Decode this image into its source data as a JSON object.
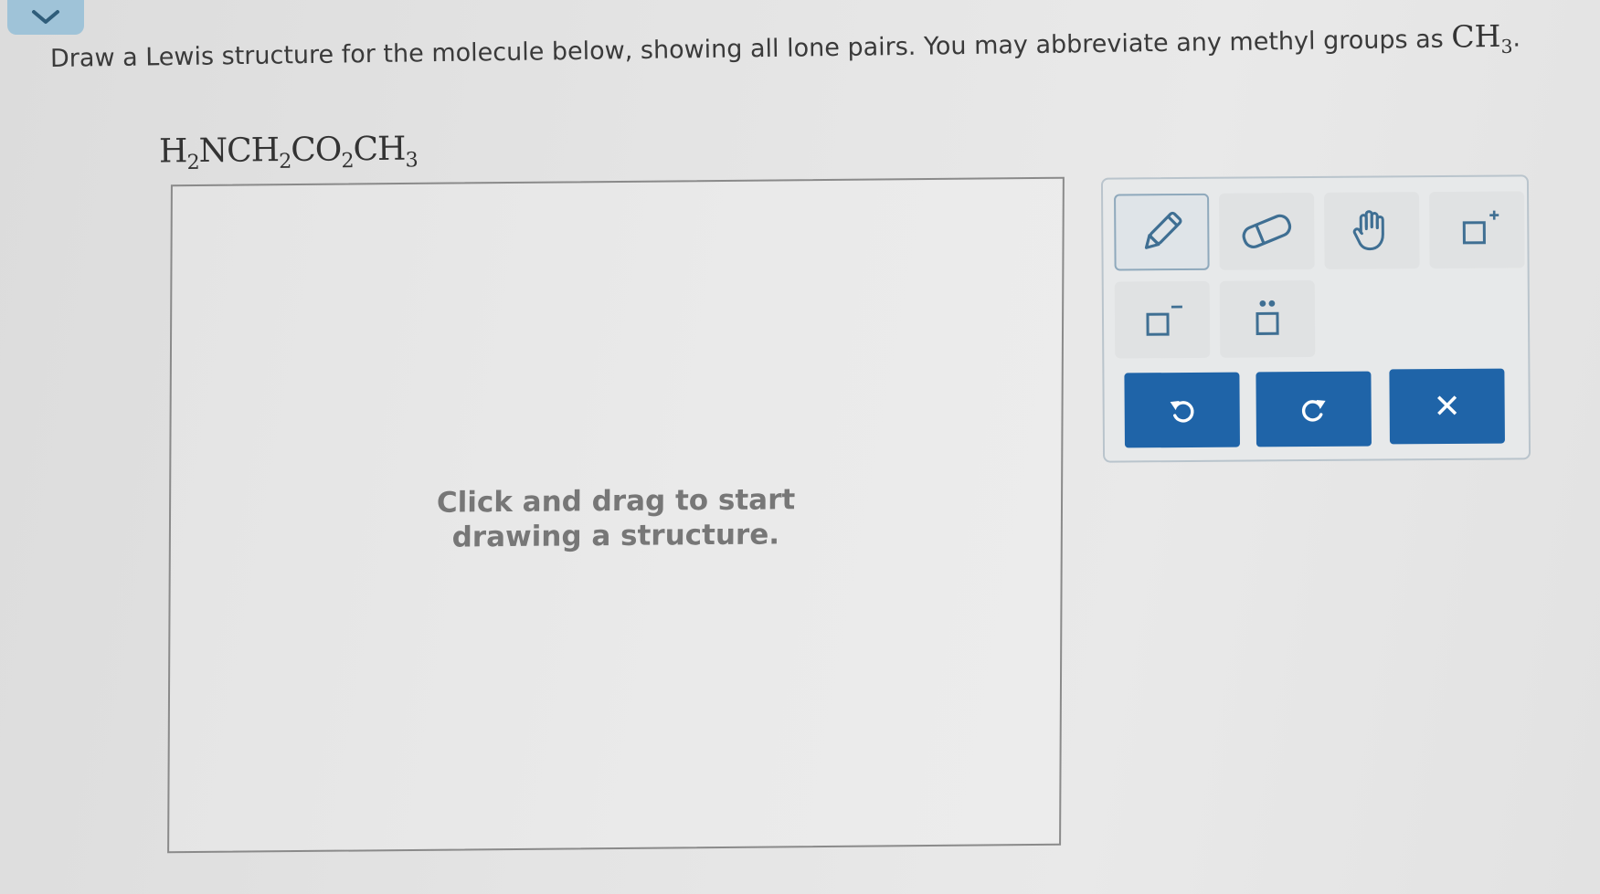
{
  "instruction": {
    "text": "Draw a Lewis structure for the molecule below, showing all lone pairs. You may abbreviate any methyl groups as ",
    "methyl": {
      "main": "CH",
      "sub": "3",
      "end": "."
    }
  },
  "formula": {
    "parts": [
      {
        "t": "H",
        "s": "2"
      },
      {
        "t": "NCH",
        "s": "2"
      },
      {
        "t": "CO",
        "s": "2"
      },
      {
        "t": "CH",
        "s": "3"
      }
    ]
  },
  "canvas": {
    "hint": "Click and drag to start\ndrawing a structure."
  },
  "toolbar": {
    "tools": [
      {
        "name": "pencil-tool",
        "icon": "pencil-icon",
        "active": true
      },
      {
        "name": "eraser-tool",
        "icon": "eraser-icon",
        "active": false
      },
      {
        "name": "move-tool",
        "icon": "hand-icon",
        "active": false
      },
      {
        "name": "positive-charge-tool",
        "icon": "positive-charge-icon",
        "active": false
      },
      {
        "name": "negative-charge-tool",
        "icon": "negative-charge-icon",
        "active": false
      },
      {
        "name": "lone-pair-tool",
        "icon": "lone-pair-icon",
        "active": false
      }
    ],
    "actions": {
      "undo_icon": "undo-icon",
      "redo_icon": "redo-icon",
      "clear_label": "✕"
    }
  },
  "colors": {
    "action_blue": "#1f64a8",
    "tab_blue": "#9fc3d8"
  }
}
